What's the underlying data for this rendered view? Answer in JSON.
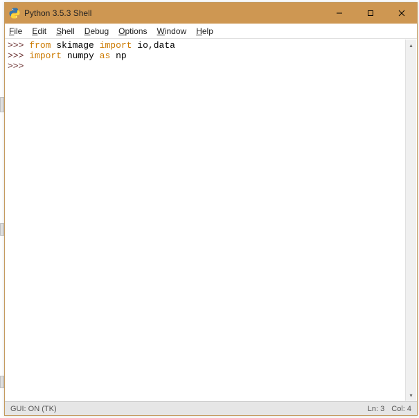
{
  "window": {
    "title": "Python 3.5.3 Shell"
  },
  "menu": {
    "file": {
      "accelerator": "F",
      "rest": "ile"
    },
    "edit": {
      "accelerator": "E",
      "rest": "dit"
    },
    "shell": {
      "accelerator": "S",
      "rest": "hell"
    },
    "debug": {
      "accelerator": "D",
      "rest": "ebug"
    },
    "options": {
      "accelerator": "O",
      "rest": "ptions"
    },
    "window_menu": {
      "accelerator": "W",
      "rest": "indow"
    },
    "help": {
      "accelerator": "H",
      "rest": "elp"
    }
  },
  "code": {
    "prompt": ">>>",
    "line1": {
      "kw_from": "from",
      "module1": "skimage",
      "kw_import": "import",
      "item1": "io",
      "comma": ",",
      "item2": "data"
    },
    "line2": {
      "kw_import": "import",
      "module": "numpy",
      "kw_as": "as",
      "alias": "np"
    }
  },
  "status": {
    "left": "GUI: ON (TK)",
    "ln_label": "Ln:",
    "ln_value": "3",
    "col_label": "Col:",
    "col_value": "4"
  }
}
